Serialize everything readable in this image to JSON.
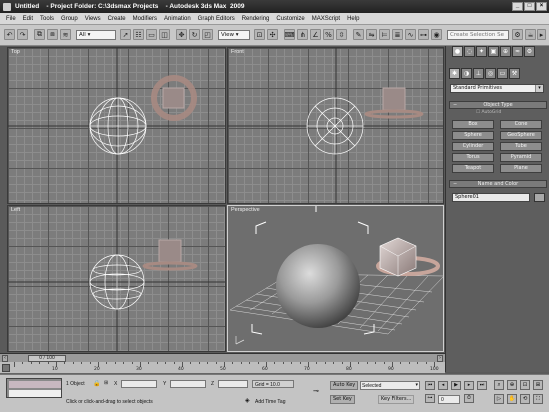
{
  "window": {
    "title": "Untitled    - Project Folder: C:\\3dsmax Projects    - Autodesk 3ds Max  2009",
    "controls": [
      "_",
      "□",
      "×"
    ]
  },
  "menu": [
    "File",
    "Edit",
    "Tools",
    "Group",
    "Views",
    "Create",
    "Modifiers",
    "Animation",
    "Graph Editors",
    "Rendering",
    "Customize",
    "MAXScript",
    "Help"
  ],
  "toolbar": {
    "selection_filter": "All",
    "reference_coord": "View",
    "named_selection_placeholder": "Create Selection Se"
  },
  "viewports": [
    {
      "label": "Top"
    },
    {
      "label": "Front"
    },
    {
      "label": "Left"
    },
    {
      "label": "Perspective"
    }
  ],
  "command_panel": {
    "category": "Standard Primitives",
    "object_type_rollout": "Object Type",
    "autogrid": "AutoGrid",
    "buttons": [
      "Box",
      "Cone",
      "Sphere",
      "GeoSphere",
      "Cylinder",
      "Tube",
      "Torus",
      "Pyramid",
      "Teapot",
      "Plane"
    ],
    "name_color_rollout": "Name and Color",
    "object_name": "Sphere01",
    "swatch_color": "#a8a8a8"
  },
  "time": {
    "slider": "0 / 100",
    "ticks": [
      "0",
      "10",
      "20",
      "30",
      "40",
      "50",
      "60",
      "70",
      "80",
      "90",
      "100"
    ]
  },
  "status": {
    "selected": "1 Object",
    "x_label": "X",
    "y_label": "Y",
    "z_label": "Z",
    "grid": "Grid = 10.0",
    "prompt": "Click or click-and-drag to select objects",
    "add_time_tag": "Add Time Tag",
    "auto_key": "Auto Key",
    "set_key": "Set Key",
    "key_mode": "Selected",
    "key_filters": "Key Filters...",
    "frame": "0"
  }
}
